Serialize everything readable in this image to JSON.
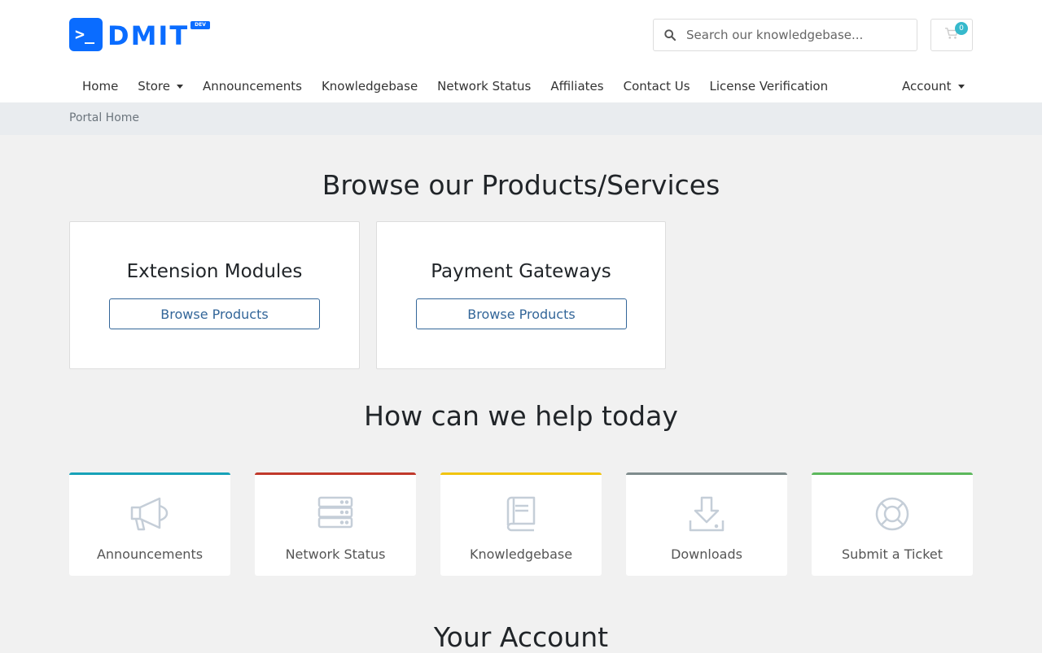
{
  "header": {
    "logo_text": "DMIT",
    "logo_badge": "DEV",
    "logo_prompt": ">_",
    "search_placeholder": "Search our knowledgebase...",
    "cart_count": "0"
  },
  "nav": {
    "items": [
      "Home",
      "Store",
      "Announcements",
      "Knowledgebase",
      "Network Status",
      "Affiliates",
      "Contact Us",
      "License Verification"
    ],
    "account": "Account"
  },
  "breadcrumb": {
    "current": "Portal Home"
  },
  "products": {
    "heading": "Browse our Products/Services",
    "cards": [
      {
        "title": "Extension Modules",
        "button": "Browse Products"
      },
      {
        "title": "Payment Gateways",
        "button": "Browse Products"
      }
    ]
  },
  "help": {
    "heading": "How can we help today",
    "cards": [
      {
        "label": "Announcements",
        "icon": "megaphone-icon",
        "color": "#17a2b8"
      },
      {
        "label": "Network Status",
        "icon": "server-icon",
        "color": "#c0392b"
      },
      {
        "label": "Knowledgebase",
        "icon": "book-icon",
        "color": "#f1c40f"
      },
      {
        "label": "Downloads",
        "icon": "download-icon",
        "color": "#7f8c8d"
      },
      {
        "label": "Submit a Ticket",
        "icon": "lifebuoy-icon",
        "color": "#5cb85c"
      }
    ]
  },
  "account": {
    "heading": "Your Account"
  },
  "colors": {
    "brand": "#0a6cff",
    "link": "#336699",
    "badge": "#36b9cc",
    "icon": "#c5ced8"
  }
}
